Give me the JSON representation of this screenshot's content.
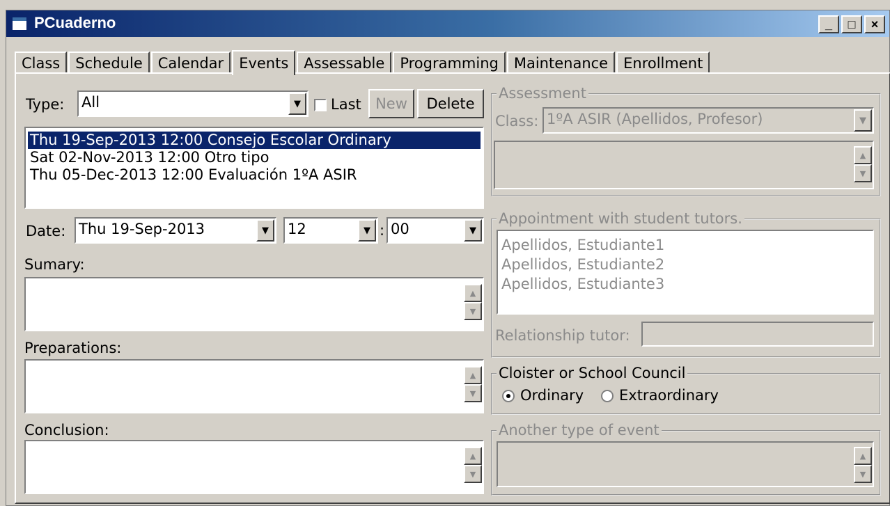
{
  "window": {
    "title": "PCuaderno",
    "buttons": {
      "minimize": "_",
      "maximize": "□",
      "close": "×"
    }
  },
  "tabs": [
    {
      "label": "Class"
    },
    {
      "label": "Schedule"
    },
    {
      "label": "Calendar"
    },
    {
      "label": "Events",
      "active": true
    },
    {
      "label": "Assessable"
    },
    {
      "label": "Programming"
    },
    {
      "label": "Maintenance"
    },
    {
      "label": "Enrollment"
    }
  ],
  "events": {
    "type_label": "Type:",
    "type_value": "All",
    "last_label": "Last",
    "last_checked": false,
    "new_label": "New",
    "delete_label": "Delete",
    "list": [
      {
        "text": "Thu 19-Sep-2013 12:00  Consejo Escolar Ordinary",
        "selected": true
      },
      {
        "text": "Sat 02-Nov-2013 12:00  Otro tipo",
        "selected": false
      },
      {
        "text": "Thu 05-Dec-2013 12:00  Evaluación 1ºA ASIR",
        "selected": false
      }
    ],
    "date_label": "Date:",
    "date_value": "Thu 19-Sep-2013",
    "hour_value": "12",
    "time_separator": ":",
    "minute_value": "00",
    "summary_label": "Sumary:",
    "preparations_label": "Preparations:",
    "conclusion_label": "Conclusion:"
  },
  "assessment": {
    "legend": "Assessment",
    "class_label": "Class:",
    "class_value": "1ºA ASIR (Apellidos, Profesor)"
  },
  "appointment": {
    "legend": "Appointment with student tutors.",
    "students": [
      "Apellidos, Estudiante1",
      "Apellidos, Estudiante2",
      "Apellidos, Estudiante3"
    ],
    "relationship_label": "Relationship tutor:"
  },
  "council": {
    "legend": "Cloister or School Council",
    "ordinary_label": "Ordinary",
    "extraordinary_label": "Extraordinary",
    "selected": "ordinary"
  },
  "another": {
    "legend": "Another type of event"
  },
  "colors": {
    "face": "#d4d0c8",
    "selection": "#0a246a",
    "disabled_text": "#8a8a8a"
  },
  "icons": {
    "dropdown": "▼",
    "scroll_up": "▲",
    "scroll_down": "▼"
  }
}
